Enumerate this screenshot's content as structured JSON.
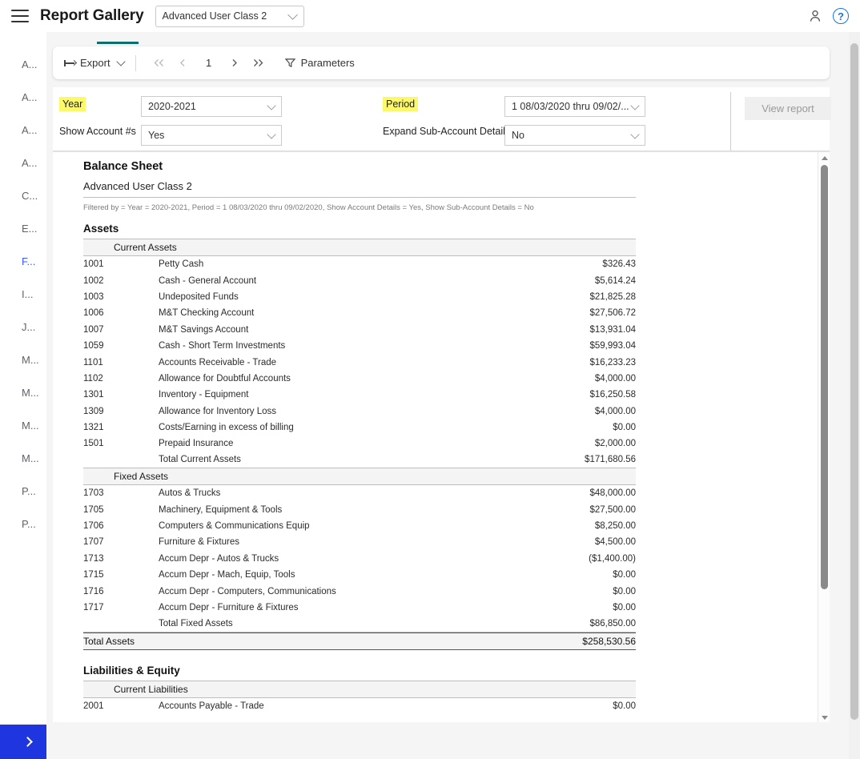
{
  "appbar": {
    "menu_icon": "hamburger-icon",
    "title": "Report Gallery",
    "class_selector": {
      "value": "Advanced User Class 2"
    },
    "account_icon": "person-icon",
    "help_icon": "help-icon",
    "help_label": "?"
  },
  "sidebar": {
    "items": [
      {
        "label": "A...",
        "active": false
      },
      {
        "label": "A...",
        "active": false
      },
      {
        "label": "A...",
        "active": false
      },
      {
        "label": "A...",
        "active": false
      },
      {
        "label": "C...",
        "active": false
      },
      {
        "label": "E...",
        "active": false
      },
      {
        "label": "F...",
        "active": true
      },
      {
        "label": "I...",
        "active": false
      },
      {
        "label": "J...",
        "active": false
      },
      {
        "label": "M...",
        "active": false
      },
      {
        "label": "M...",
        "active": false
      },
      {
        "label": "M...",
        "active": false
      },
      {
        "label": "M...",
        "active": false
      },
      {
        "label": "P...",
        "active": false
      },
      {
        "label": "P...",
        "active": false
      }
    ],
    "expand_button": {
      "icon": "chevron-right-icon"
    }
  },
  "toolbar": {
    "export_label": "Export",
    "page_number": "1",
    "first_page_icon": "double-chevron-left-icon",
    "prev_page_icon": "chevron-left-icon",
    "next_page_icon": "chevron-right-icon",
    "last_page_icon": "double-chevron-right-icon",
    "parameters_label": "Parameters",
    "parameters_icon": "funnel-icon"
  },
  "parameters": {
    "year": {
      "label": "Year",
      "value": "2020-2021",
      "highlighted": true
    },
    "period": {
      "label": "Period",
      "value": "1 08/03/2020 thru 09/02/...",
      "highlighted": true
    },
    "show_account_numbers": {
      "label": "Show Account #s",
      "value": "Yes"
    },
    "expand_sub_account_detail": {
      "label": "Expand Sub-Account Detail",
      "value": "No"
    },
    "view_report_button": "View report"
  },
  "report": {
    "title": "Balance Sheet",
    "subtitle": "Advanced User Class 2",
    "filter_text": "Filtered by = Year = 2020-2021, Period = 1 08/03/2020 thru 09/02/2020, Show Account Details = Yes, Show Sub-Account Details = No",
    "sections": [
      {
        "heading": "Assets",
        "groups": [
          {
            "name": "Current Assets",
            "rows": [
              {
                "account": "1001",
                "name": "Petty Cash",
                "amount": "$326.43"
              },
              {
                "account": "1002",
                "name": "Cash - General Account",
                "amount": "$5,614.24"
              },
              {
                "account": "1003",
                "name": "Undeposited Funds",
                "amount": "$21,825.28"
              },
              {
                "account": "1006",
                "name": "M&T Checking Account",
                "amount": "$27,506.72"
              },
              {
                "account": "1007",
                "name": "M&T Savings Account",
                "amount": "$13,931.04"
              },
              {
                "account": "1059",
                "name": "Cash - Short Term Investments",
                "amount": "$59,993.04"
              },
              {
                "account": "1101",
                "name": "Accounts Receivable - Trade",
                "amount": "$16,233.23"
              },
              {
                "account": "1102",
                "name": "Allowance for Doubtful Accounts",
                "amount": "$4,000.00"
              },
              {
                "account": "1301",
                "name": "Inventory - Equipment",
                "amount": "$16,250.58"
              },
              {
                "account": "1309",
                "name": "Allowance for Inventory Loss",
                "amount": "$4,000.00"
              },
              {
                "account": "1321",
                "name": "Costs/Earning in excess of billing",
                "amount": "$0.00"
              },
              {
                "account": "1501",
                "name": "Prepaid Insurance",
                "amount": "$2,000.00"
              }
            ],
            "total": {
              "name": "Total Current Assets",
              "amount": "$171,680.56"
            }
          },
          {
            "name": "Fixed Assets",
            "rows": [
              {
                "account": "1703",
                "name": "Autos & Trucks",
                "amount": "$48,000.00"
              },
              {
                "account": "1705",
                "name": "Machinery, Equipment & Tools",
                "amount": "$27,500.00"
              },
              {
                "account": "1706",
                "name": "Computers & Communications Equip",
                "amount": "$8,250.00"
              },
              {
                "account": "1707",
                "name": "Furniture & Fixtures",
                "amount": "$4,500.00"
              },
              {
                "account": "1713",
                "name": "Accum Depr - Autos & Trucks",
                "amount": "($1,400.00)"
              },
              {
                "account": "1715",
                "name": "Accum Depr - Mach, Equip, Tools",
                "amount": "$0.00"
              },
              {
                "account": "1716",
                "name": "Accum Depr - Computers, Communications",
                "amount": "$0.00"
              },
              {
                "account": "1717",
                "name": "Accum Depr - Furniture & Fixtures",
                "amount": "$0.00"
              }
            ],
            "total": {
              "name": "Total Fixed Assets",
              "amount": "$86,850.00"
            }
          }
        ],
        "section_total": {
          "name": "Total Assets",
          "amount": "$258,530.56"
        }
      },
      {
        "heading": "Liabilities & Equity",
        "groups": [
          {
            "name": "Current Liabilities",
            "rows": [
              {
                "account": "2001",
                "name": "Accounts Payable - Trade",
                "amount": "$0.00"
              }
            ],
            "total": null
          }
        ],
        "section_total": null
      }
    ]
  },
  "colors": {
    "accent_blue": "#3b5bfd",
    "expand_button_blue": "#1f35e0",
    "tab_underline_teal": "#0f6e6e",
    "highlight_yellow": "#fbf96b",
    "help_blue": "#1a73e8"
  }
}
